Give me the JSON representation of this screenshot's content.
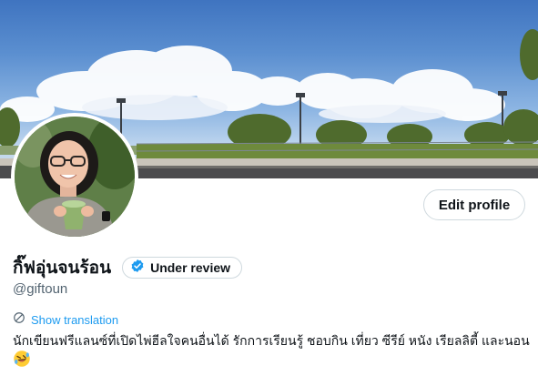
{
  "profile": {
    "display_name": "กิ๊ฟอุ่นจนร้อน",
    "verification_label": "Under review",
    "handle": "@giftoun",
    "bio": "นักเขียนฟรีแลนซ์ที่เปิดไพ่ฮีลใจคนอื่นได้ รักการเรียนรู้ ชอบกิน เที่ยว ซีรีย์ หนัง เรียลลิตี้ และนอน",
    "bio_emoji": "rolling-on-the-floor-laughing"
  },
  "actions": {
    "edit_profile_label": "Edit profile",
    "show_translation_label": "Show translation"
  },
  "colors": {
    "accent": "#1d9bf0",
    "text": "#0f1419",
    "muted": "#536471",
    "border": "#cfd9de"
  },
  "icons": {
    "verified": "blue-check-badge",
    "translate": "translate-icon"
  }
}
